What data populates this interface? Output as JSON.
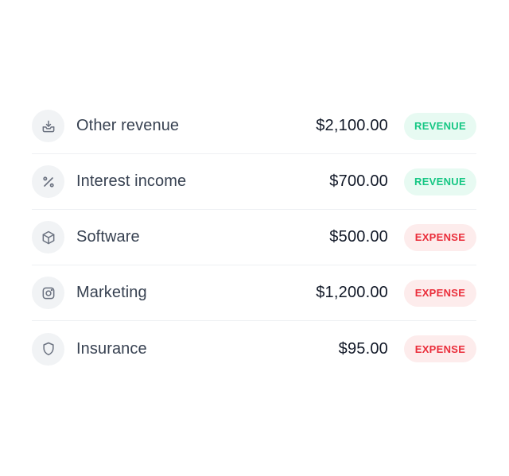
{
  "colors": {
    "revenue_text": "#16c784",
    "revenue_bg": "#e7faf2",
    "expense_text": "#ea2d3a",
    "expense_bg": "#fdecec",
    "icon_bg": "#f1f3f5",
    "icon_stroke": "#6b7280"
  },
  "transactions": [
    {
      "icon": "inbox-download-icon",
      "label": "Other revenue",
      "amount": "$2,100.00",
      "type": "REVENUE"
    },
    {
      "icon": "percent-icon",
      "label": "Interest income",
      "amount": "$700.00",
      "type": "REVENUE"
    },
    {
      "icon": "cube-icon",
      "label": "Software",
      "amount": "$500.00",
      "type": "EXPENSE"
    },
    {
      "icon": "instagram-icon",
      "label": "Marketing",
      "amount": "$1,200.00",
      "type": "EXPENSE"
    },
    {
      "icon": "shield-icon",
      "label": "Insurance",
      "amount": "$95.00",
      "type": "EXPENSE"
    }
  ]
}
